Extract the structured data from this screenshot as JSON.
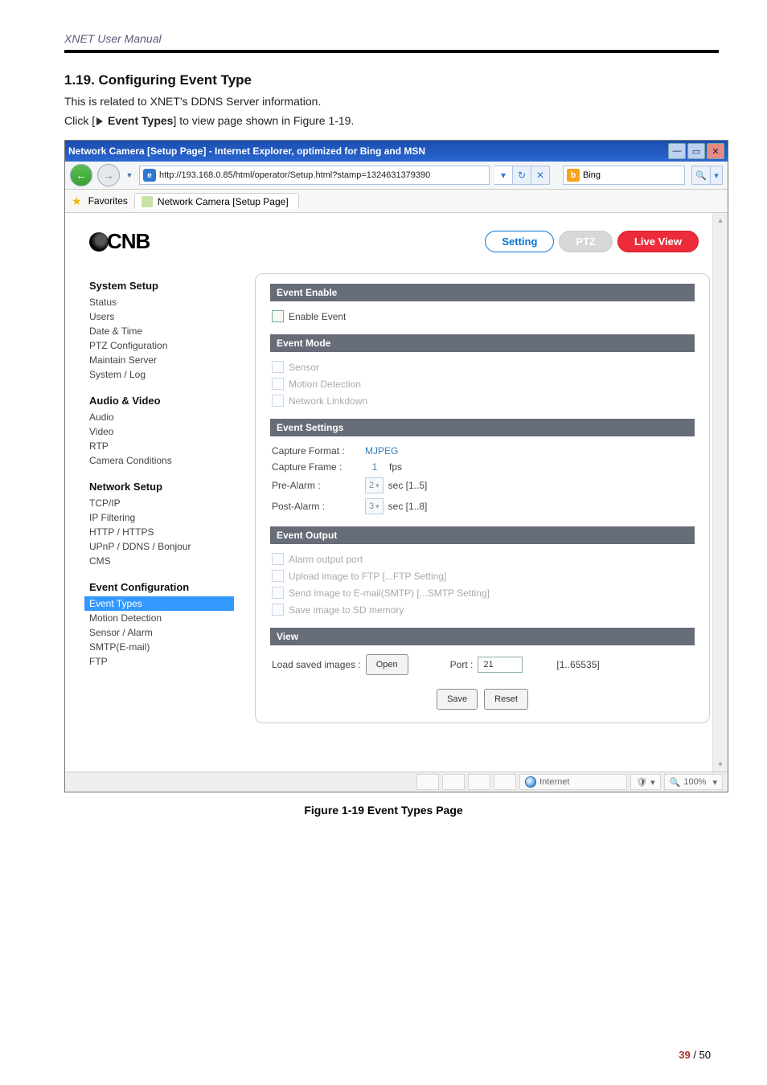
{
  "doc": {
    "header": "XNET User Manual",
    "section_title": "1.19. Configuring Event Type",
    "p1": "This is related to XNET's DDNS Server information.",
    "p2_a": "Click [",
    "p2_b": " Event Types",
    "p2_c": "] to view page shown in Figure 1-19.",
    "figure_caption": "Figure 1-19 Event Types Page",
    "page_num": "39",
    "page_total": " / 50"
  },
  "win": {
    "title": "Network Camera [Setup Page] - Internet Explorer, optimized for Bing and MSN",
    "url": "http://193.168.0.85/html/operator/Setup.html?stamp=1324631379390",
    "search_engine": "Bing",
    "favorites_label": "Favorites",
    "tab_label": "Network Camera [Setup Page]",
    "status_zone": "Internet",
    "zoom": "100%"
  },
  "top": {
    "setting": "Setting",
    "ptz": "PTZ",
    "live": "Live View"
  },
  "sidebar": {
    "h1": "System Setup",
    "g1": [
      "Status",
      "Users",
      "Date & Time",
      "PTZ Configuration",
      "Maintain Server",
      "System / Log"
    ],
    "h2": "Audio & Video",
    "g2": [
      "Audio",
      "Video",
      "RTP",
      "Camera Conditions"
    ],
    "h3": "Network Setup",
    "g3": [
      "TCP/IP",
      "IP Filtering",
      "HTTP / HTTPS",
      "UPnP / DDNS / Bonjour",
      "CMS"
    ],
    "h4": "Event Configuration",
    "g4": [
      "Event Types",
      "Motion Detection",
      "Sensor / Alarm",
      "SMTP(E-mail)",
      "FTP"
    ]
  },
  "form": {
    "s1": "Event Enable",
    "enable_event": "Enable Event",
    "s2": "Event Mode",
    "sensor": "Sensor",
    "motion": "Motion Detection",
    "linkdown": "Network Linkdown",
    "s3": "Event Settings",
    "cap_fmt_l": "Capture Format :",
    "cap_fmt_v": "MJPEG",
    "cap_frame_l": "Capture Frame :",
    "cap_frame_v": "1",
    "cap_frame_u": "fps",
    "pre_l": "Pre-Alarm :",
    "pre_v": "2",
    "pre_u": "sec [1..5]",
    "post_l": "Post-Alarm :",
    "post_v": "3",
    "post_u": "sec [1..8]",
    "s4": "Event Output",
    "alarm_port": "Alarm output port",
    "upload_ftp": "Upload image to FTP   [...FTP Setting]",
    "send_smtp": "Send image to E-mail(SMTP)   [...SMTP Setting]",
    "save_sd": "Save image to SD memory",
    "s5": "View",
    "load_l": "Load saved images :",
    "open": "Open",
    "port_l": "Port :",
    "port_v": "21",
    "port_range": "[1..65535]",
    "save": "Save",
    "reset": "Reset"
  }
}
